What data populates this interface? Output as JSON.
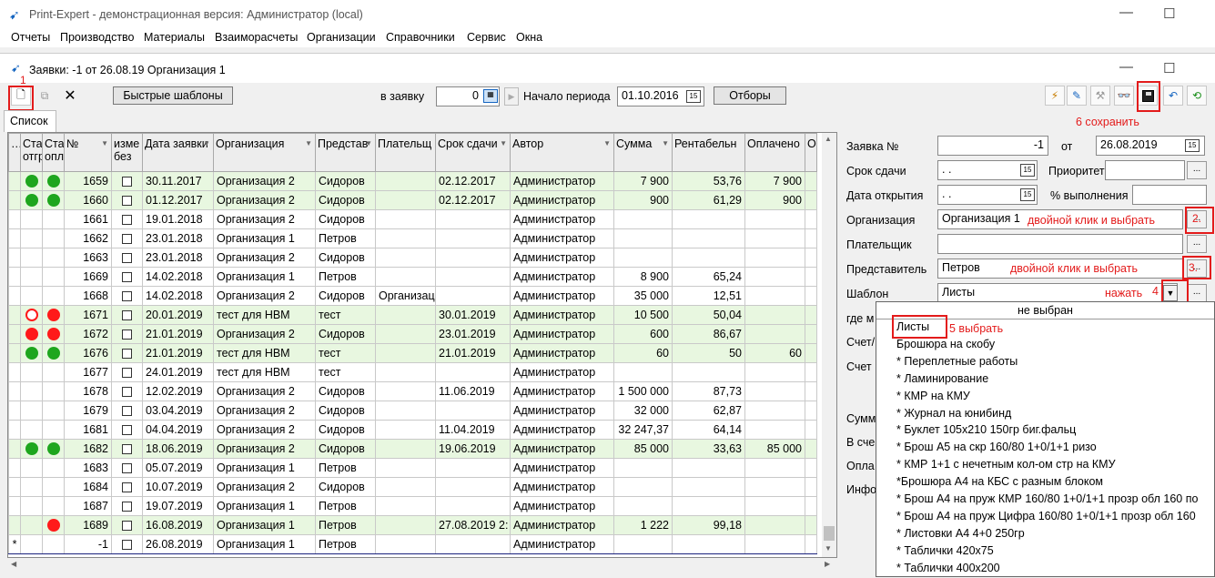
{
  "app": {
    "title": "Print-Expert - демонстрационная версия: Администратор (local)"
  },
  "menu": [
    "Отчеты",
    "Производство",
    "Материалы",
    "Взаиморасчеты",
    "Организации",
    "Справочники",
    "Сервис",
    "Окна"
  ],
  "child": {
    "title": "Заявки: -1 от 26.08.19  Организация 1"
  },
  "toolbar": {
    "quick_templates": "Быстрые шаблоны",
    "to_order_label": "в заявку",
    "to_order_value": "0",
    "period_label": "Начало периода",
    "period_value": "01.10.2016",
    "filters": "Отборы"
  },
  "tab": "Список",
  "grid": {
    "columns": [
      "Ста отгр",
      "Ста опл",
      "№",
      "изме без",
      "Дата заявки",
      "Организация",
      "Представ",
      "Плательщ",
      "Срок сдачи",
      "Автор",
      "Сумма",
      "Рентабельн",
      "Оплачено",
      "О"
    ],
    "rows": [
      {
        "s1": "green",
        "s2": "green",
        "n": "1659",
        "date": "30.11.2017",
        "org": "Организация 2",
        "rep": "Сидоров",
        "payer": "",
        "due": "02.12.2017",
        "author": "Администратор",
        "sum": "7 900",
        "rent": "53,76",
        "paid": "7 900",
        "hl": true
      },
      {
        "s1": "green",
        "s2": "green",
        "n": "1660",
        "date": "01.12.2017",
        "org": "Организация 2",
        "rep": "Сидоров",
        "payer": "",
        "due": "02.12.2017",
        "author": "Администратор",
        "sum": "900",
        "rent": "61,29",
        "paid": "900",
        "hl": true
      },
      {
        "s1": "",
        "s2": "",
        "n": "1661",
        "date": "19.01.2018",
        "org": "Организация 2",
        "rep": "Сидоров",
        "payer": "",
        "due": "",
        "author": "Администратор",
        "sum": "",
        "rent": "",
        "paid": "",
        "hl": false
      },
      {
        "s1": "",
        "s2": "",
        "n": "1662",
        "date": "23.01.2018",
        "org": "Организация 1",
        "rep": "Петров",
        "payer": "",
        "due": "",
        "author": "Администратор",
        "sum": "",
        "rent": "",
        "paid": "",
        "hl": false
      },
      {
        "s1": "",
        "s2": "",
        "n": "1663",
        "date": "23.01.2018",
        "org": "Организация 2",
        "rep": "Сидоров",
        "payer": "",
        "due": "",
        "author": "Администратор",
        "sum": "",
        "rent": "",
        "paid": "",
        "hl": false
      },
      {
        "s1": "",
        "s2": "",
        "n": "1669",
        "date": "14.02.2018",
        "org": "Организация 1",
        "rep": "Петров",
        "payer": "",
        "due": "",
        "author": "Администратор",
        "sum": "8 900",
        "rent": "65,24",
        "paid": "",
        "hl": false
      },
      {
        "s1": "",
        "s2": "",
        "n": "1668",
        "date": "14.02.2018",
        "org": "Организация 2",
        "rep": "Сидоров",
        "payer": "Организац",
        "due": "",
        "author": "Администратор",
        "sum": "35 000",
        "rent": "12,51",
        "paid": "",
        "hl": false
      },
      {
        "s1": "ring",
        "s2": "red",
        "n": "1671",
        "date": "20.01.2019",
        "org": "тест для НВМ",
        "rep": "тест",
        "payer": "",
        "due": "30.01.2019",
        "author": "Администратор",
        "sum": "10 500",
        "rent": "50,04",
        "paid": "",
        "hl": true
      },
      {
        "s1": "red",
        "s2": "red",
        "n": "1672",
        "date": "21.01.2019",
        "org": "Организация 2",
        "rep": "Сидоров",
        "payer": "",
        "due": "23.01.2019",
        "author": "Администратор",
        "sum": "600",
        "rent": "86,67",
        "paid": "",
        "hl": true
      },
      {
        "s1": "green",
        "s2": "green",
        "n": "1676",
        "date": "21.01.2019",
        "org": "тест для НВМ",
        "rep": "тест",
        "payer": "",
        "due": "21.01.2019",
        "author": "Администратор",
        "sum": "60",
        "rent": "50",
        "paid": "60",
        "hl": true
      },
      {
        "s1": "",
        "s2": "",
        "n": "1677",
        "date": "24.01.2019",
        "org": "тест для НВМ",
        "rep": "тест",
        "payer": "",
        "due": "",
        "author": "Администратор",
        "sum": "",
        "rent": "",
        "paid": "",
        "hl": false
      },
      {
        "s1": "",
        "s2": "",
        "n": "1678",
        "date": "12.02.2019",
        "org": "Организация 2",
        "rep": "Сидоров",
        "payer": "",
        "due": "11.06.2019",
        "author": "Администратор",
        "sum": "1 500 000",
        "rent": "87,73",
        "paid": "",
        "hl": false
      },
      {
        "s1": "",
        "s2": "",
        "n": "1679",
        "date": "03.04.2019",
        "org": "Организация 2",
        "rep": "Сидоров",
        "payer": "",
        "due": "",
        "author": "Администратор",
        "sum": "32 000",
        "rent": "62,87",
        "paid": "",
        "hl": false
      },
      {
        "s1": "",
        "s2": "",
        "n": "1681",
        "date": "04.04.2019",
        "org": "Организация 2",
        "rep": "Сидоров",
        "payer": "",
        "due": "11.04.2019",
        "author": "Администратор",
        "sum": "32 247,37",
        "rent": "64,14",
        "paid": "",
        "hl": false
      },
      {
        "s1": "green",
        "s2": "green",
        "n": "1682",
        "date": "18.06.2019",
        "org": "Организация 2",
        "rep": "Сидоров",
        "payer": "",
        "due": "19.06.2019",
        "author": "Администратор",
        "sum": "85 000",
        "rent": "33,63",
        "paid": "85 000",
        "hl": true
      },
      {
        "s1": "",
        "s2": "",
        "n": "1683",
        "date": "05.07.2019",
        "org": "Организация 1",
        "rep": "Петров",
        "payer": "",
        "due": "",
        "author": "Администратор",
        "sum": "",
        "rent": "",
        "paid": "",
        "hl": false
      },
      {
        "s1": "",
        "s2": "",
        "n": "1684",
        "date": "10.07.2019",
        "org": "Организация 2",
        "rep": "Сидоров",
        "payer": "",
        "due": "",
        "author": "Администратор",
        "sum": "",
        "rent": "",
        "paid": "",
        "hl": false
      },
      {
        "s1": "",
        "s2": "",
        "n": "1687",
        "date": "19.07.2019",
        "org": "Организация 1",
        "rep": "Петров",
        "payer": "",
        "due": "",
        "author": "Администратор",
        "sum": "",
        "rent": "",
        "paid": "",
        "hl": false
      },
      {
        "s1": "",
        "s2": "red",
        "n": "1689",
        "date": "16.08.2019",
        "org": "Организация 1",
        "rep": "Петров",
        "payer": "",
        "due": "27.08.2019 2:",
        "author": "Администратор",
        "sum": "1 222",
        "rent": "99,18",
        "paid": "",
        "hl": true
      },
      {
        "s1": "",
        "s2": "",
        "n": "-1",
        "date": "26.08.2019",
        "org": "Организация 1",
        "rep": "Петров",
        "payer": "",
        "due": "",
        "author": "Администратор",
        "sum": "",
        "rent": "",
        "paid": "",
        "hl": false,
        "sel": true,
        "marker": "*"
      }
    ]
  },
  "form": {
    "order_no_label": "Заявка №",
    "order_no_value": "-1",
    "from_label": "от",
    "from_value": "26.08.2019",
    "due_label": "Срок сдачи",
    "due_value": "  .  .",
    "priority_label": "Приоритет",
    "open_label": "Дата открытия",
    "open_value": "  .  .",
    "percent_label": "% выполнения",
    "org_label": "Организация",
    "org_value": "Организация 1",
    "payer_label": "Плательщик",
    "rep_label": "Представитель",
    "rep_value": "Петров",
    "template_label": "Шаблон",
    "template_value": "Листы",
    "partial_labels": [
      "где м",
      "Счет/",
      "Счет",
      "Сумм",
      "В сче",
      "Опла",
      "Инфо"
    ]
  },
  "dropdown": {
    "header": "не выбран",
    "items": [
      "Листы",
      "Брошюра на скобу",
      "* Переплетные работы",
      "* Ламинирование",
      "* КМР на КМУ",
      "* Журнал на юнибинд",
      "* Буклет 105х210 150гр биг.фальц",
      "* Брош А5 на скр 160/80 1+0/1+1 ризо",
      "* КМР 1+1 с нечетным кол-ом стр на КМУ",
      "*Брошюра А4 на КБС с разным блоком",
      "* Брош А4 на пруж КМР 160/80 1+0/1+1 прозр обл 160 по",
      "* Брош А4 на пруж Цифра 160/80 1+0/1+1 прозр обл 160",
      "* Листовки А4 4+0 250гр",
      "* Таблички 420х75",
      "* Таблички 400х200"
    ]
  },
  "annotations": {
    "a1": "1",
    "a2": "двойной клик и выбрать",
    "a2n": "2.",
    "a3": "двойной клик и выбрать",
    "a3n": "3.",
    "a4": "нажать",
    "a4n": "4",
    "a5": "5 выбрать",
    "a6": "6  сохранить"
  },
  "colors": {
    "status_green": "#1ea61e",
    "status_red": "#ff1a1a",
    "annotation": "#e31b1b",
    "row_highlight": "#e8f7e0"
  }
}
